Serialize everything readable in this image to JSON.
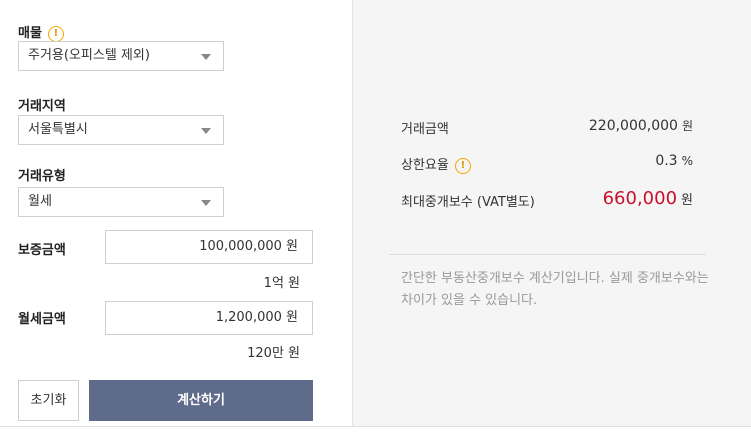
{
  "form": {
    "property": {
      "label": "매물",
      "info": "!",
      "selected": "주거용(오피스텔 제외)"
    },
    "region": {
      "label": "거래지역",
      "selected": "서울특별시"
    },
    "trade_type": {
      "label": "거래유형",
      "selected": "월세"
    },
    "deposit": {
      "label": "보증금액",
      "value": "100,000,000 원",
      "hint": "1억 원"
    },
    "monthly": {
      "label": "월세금액",
      "value": "1,200,000 원",
      "hint": "120만 원"
    },
    "reset_label": "초기화",
    "calc_label": "계산하기"
  },
  "result": {
    "trade_amount": {
      "label": "거래금액",
      "value": "220,000,000",
      "unit": "원"
    },
    "rate": {
      "label": "상한요율",
      "info": "!",
      "value": "0.3",
      "unit": "%"
    },
    "fee": {
      "label": "최대중개보수 (VAT별도)",
      "value": "660,000",
      "unit": "원"
    },
    "note": "간단한 부동산중개보수 계산기입니다. 실제 중개보수와는 차이가 있을 수 있습니다."
  },
  "colors": {
    "accent_button": "#5f6b8a",
    "fee_highlight": "#c8102e",
    "info_icon": "#f0a800"
  }
}
